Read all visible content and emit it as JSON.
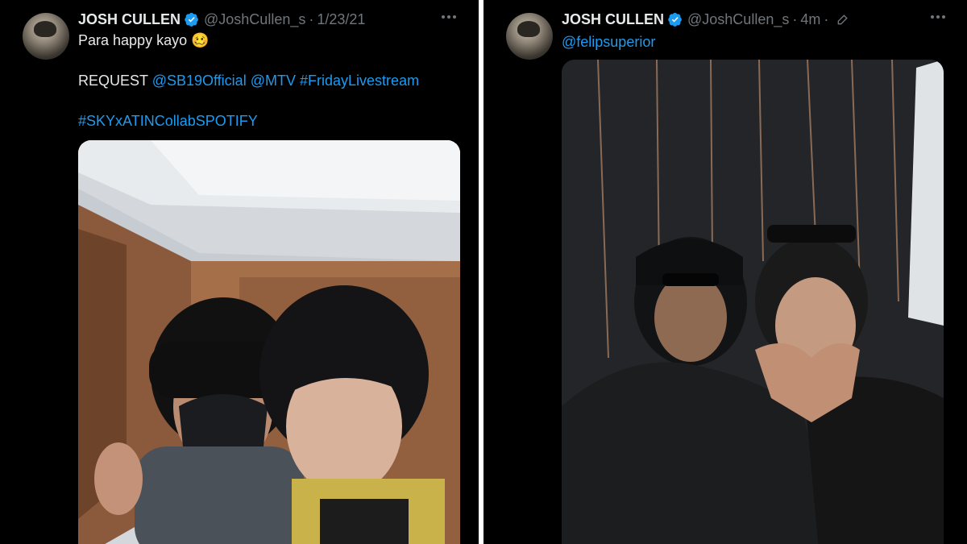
{
  "left_tweet": {
    "author_name": "JOSH CULLEN",
    "handle": "@JoshCullen_s",
    "separator": "·",
    "timestamp": "1/23/21",
    "line1_text": "Para happy kayo",
    "line1_emoji": "🥴",
    "line2_prefix": "REQUEST",
    "mention_1": "@SB19Official",
    "mention_2": "@MTV",
    "hashtag_1": "#FridayLivestream",
    "hashtag_2": "#SKYxATINCollabSPOTIFY",
    "media_icon": "photo",
    "more_icon": "more-icon"
  },
  "right_tweet": {
    "author_name": "JOSH CULLEN",
    "handle": "@JoshCullen_s",
    "separator": "·",
    "timestamp": "4m",
    "edit_icon": "pencil-icon",
    "mention": "@felipsuperior",
    "media_icon": "photo"
  },
  "colors": {
    "background": "#000000",
    "text_primary": "#e7e9ea",
    "text_secondary": "#71767b",
    "link": "#1d9bf0",
    "verified": "#1d9bf0"
  }
}
